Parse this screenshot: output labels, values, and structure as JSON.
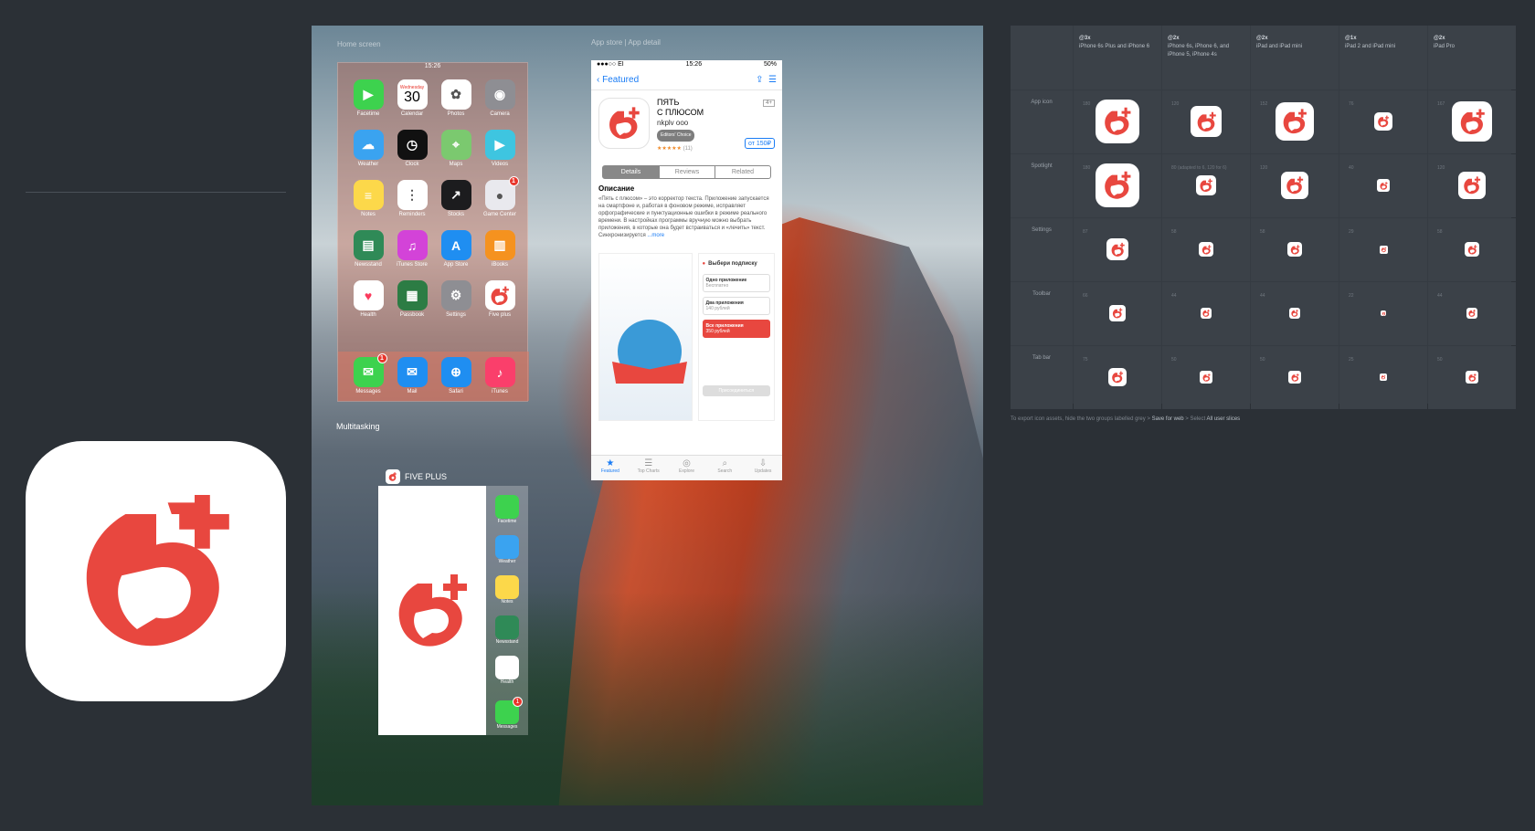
{
  "home_screen": {
    "label": "Home screen",
    "time": "15:26",
    "apps": [
      {
        "name": "Facetime",
        "icon": "facetime-icon",
        "color": "#3dd24e"
      },
      {
        "name": "Calendar",
        "icon": "calendar-icon",
        "color": "#ffffff",
        "date_day": "Wednesday",
        "date_num": "30"
      },
      {
        "name": "Photos",
        "icon": "photos-icon",
        "color": "#ffffff"
      },
      {
        "name": "Camera",
        "icon": "camera-icon",
        "color": "#8e8e93"
      },
      {
        "name": "Weather",
        "icon": "weather-icon",
        "color": "#3aa3f0"
      },
      {
        "name": "Clock",
        "icon": "clock-icon",
        "color": "#111111"
      },
      {
        "name": "Maps",
        "icon": "maps-icon",
        "color": "#7bc96f"
      },
      {
        "name": "Videos",
        "icon": "videos-icon",
        "color": "#3ec5e0"
      },
      {
        "name": "Notes",
        "icon": "notes-icon",
        "color": "#fcd84a"
      },
      {
        "name": "Reminders",
        "icon": "reminders-icon",
        "color": "#ffffff"
      },
      {
        "name": "Stocks",
        "icon": "stocks-icon",
        "color": "#1c1c1e"
      },
      {
        "name": "Game Center",
        "icon": "game-center-icon",
        "color": "#e9e9ee",
        "badge": "1"
      },
      {
        "name": "Newsstand",
        "icon": "newsstand-icon",
        "color": "#2f8a57"
      },
      {
        "name": "iTunes Store",
        "icon": "itunes-store-icon",
        "color": "#d343d8"
      },
      {
        "name": "App Store",
        "icon": "app-store-icon",
        "color": "#1f8ef1"
      },
      {
        "name": "iBooks",
        "icon": "ibooks-icon",
        "color": "#f5921f"
      },
      {
        "name": "Health",
        "icon": "health-icon",
        "color": "#ffffff"
      },
      {
        "name": "Passbook",
        "icon": "passbook-icon",
        "color": "#2c7c44"
      },
      {
        "name": "Settings",
        "icon": "settings-icon",
        "color": "#8e8e93"
      },
      {
        "name": "Five plus",
        "icon": "five-plus-icon",
        "color": "#ffffff"
      }
    ],
    "dock": [
      {
        "name": "Messages",
        "icon": "messages-icon",
        "color": "#3dd24e",
        "badge": "1"
      },
      {
        "name": "Mail",
        "icon": "mail-icon",
        "color": "#1f8ef1"
      },
      {
        "name": "Safari",
        "icon": "safari-icon",
        "color": "#1f8ef1"
      },
      {
        "name": "iTunes",
        "icon": "itunes-icon",
        "color": "#fa3f6b"
      }
    ]
  },
  "multitasking": {
    "label": "Multitasking",
    "app_title": "FIVE PLUS",
    "side_apps": [
      {
        "name": "Facetime",
        "color": "#3dd24e"
      },
      {
        "name": "Weather",
        "color": "#3aa3f0"
      },
      {
        "name": "Notes",
        "color": "#fcd84a"
      },
      {
        "name": "Newsstand",
        "color": "#2f8a57"
      },
      {
        "name": "Health",
        "color": "#ffffff"
      }
    ],
    "bottom_app": {
      "name": "Messages",
      "badge": "1"
    }
  },
  "app_store": {
    "label": "App store | App detail",
    "carrier": "●●●○○ EI",
    "time": "15:26",
    "battery": "50%",
    "back": "Featured",
    "app_name_line1": "ПЯТЬ",
    "app_name_line2": "С ПЛЮСОМ",
    "publisher": "nkplv ooo",
    "editors_choice": "Editors' Choice",
    "stars": "★★★★★",
    "rating_count": "(11)",
    "age": "4+",
    "price": "от 150₽",
    "tabs": [
      "Details",
      "Reviews",
      "Related"
    ],
    "desc_title": "Описание",
    "desc": "«Пять с плюсом» – это корректор текста. Приложение запускается на смартфоне и, работая в фоновом режиме, исправляет орфографические и пунктуационные ошибки в режиме реального времени. В настройках программы вручную можно выбрать приложения, в которые она будет встраиваться и «лечить» текст. Синхронизируется",
    "more": "...more",
    "shot2_title": "Выбери подписку",
    "plans": [
      {
        "name": "Одно приложение",
        "price": "Бесплатно"
      },
      {
        "name": "Два приложения",
        "price": "140 рублей"
      },
      {
        "name": "Все приложения",
        "price": "350 рублей"
      }
    ],
    "subscribe_btn": "Присоединиться",
    "tabbar": [
      {
        "glyph": "★",
        "label": "Featured"
      },
      {
        "glyph": "☰",
        "label": "Top Charts"
      },
      {
        "glyph": "◎",
        "label": "Explore"
      },
      {
        "glyph": "⌕",
        "label": "Search"
      },
      {
        "glyph": "⇩",
        "label": "Updates"
      }
    ]
  },
  "icon_table": {
    "columns": [
      {
        "scale": "@3x",
        "devices": "iPhone 6s Plus and iPhone 6"
      },
      {
        "scale": "@2x",
        "devices": "iPhone 6s, iPhone 6, and iPhone 5, iPhone 4s"
      },
      {
        "scale": "@2x",
        "devices": "iPad and iPad mini"
      },
      {
        "scale": "@1x",
        "devices": "iPad 2 and iPad mini"
      },
      {
        "scale": "@2x",
        "devices": "iPad Pro"
      }
    ],
    "rows": [
      {
        "label": "App icon",
        "sizes": [
          "180",
          "120",
          "152",
          "76",
          "167"
        ]
      },
      {
        "label": "Spotlight",
        "sizes": [
          "180",
          "80 (adapted to 6, 120 for 6)",
          "120",
          "40",
          "120"
        ]
      },
      {
        "label": "Settings",
        "sizes": [
          "87",
          "58",
          "58",
          "29",
          "58"
        ]
      },
      {
        "label": "Toolbar",
        "sizes": [
          "66",
          "44",
          "44",
          "22",
          "44"
        ]
      },
      {
        "label": "Tab bar",
        "sizes": [
          "75",
          "50",
          "50",
          "25",
          "50"
        ]
      }
    ]
  },
  "note": {
    "prefix": "To export icon assets, hide the two groups labelled grey > ",
    "step1": "Save for web",
    "mid": " > Select ",
    "step2": "All user slices"
  },
  "colors": {
    "background": "#2b3036",
    "brand_red": "#e8473f",
    "accent_blue": "#1a7cf5"
  }
}
